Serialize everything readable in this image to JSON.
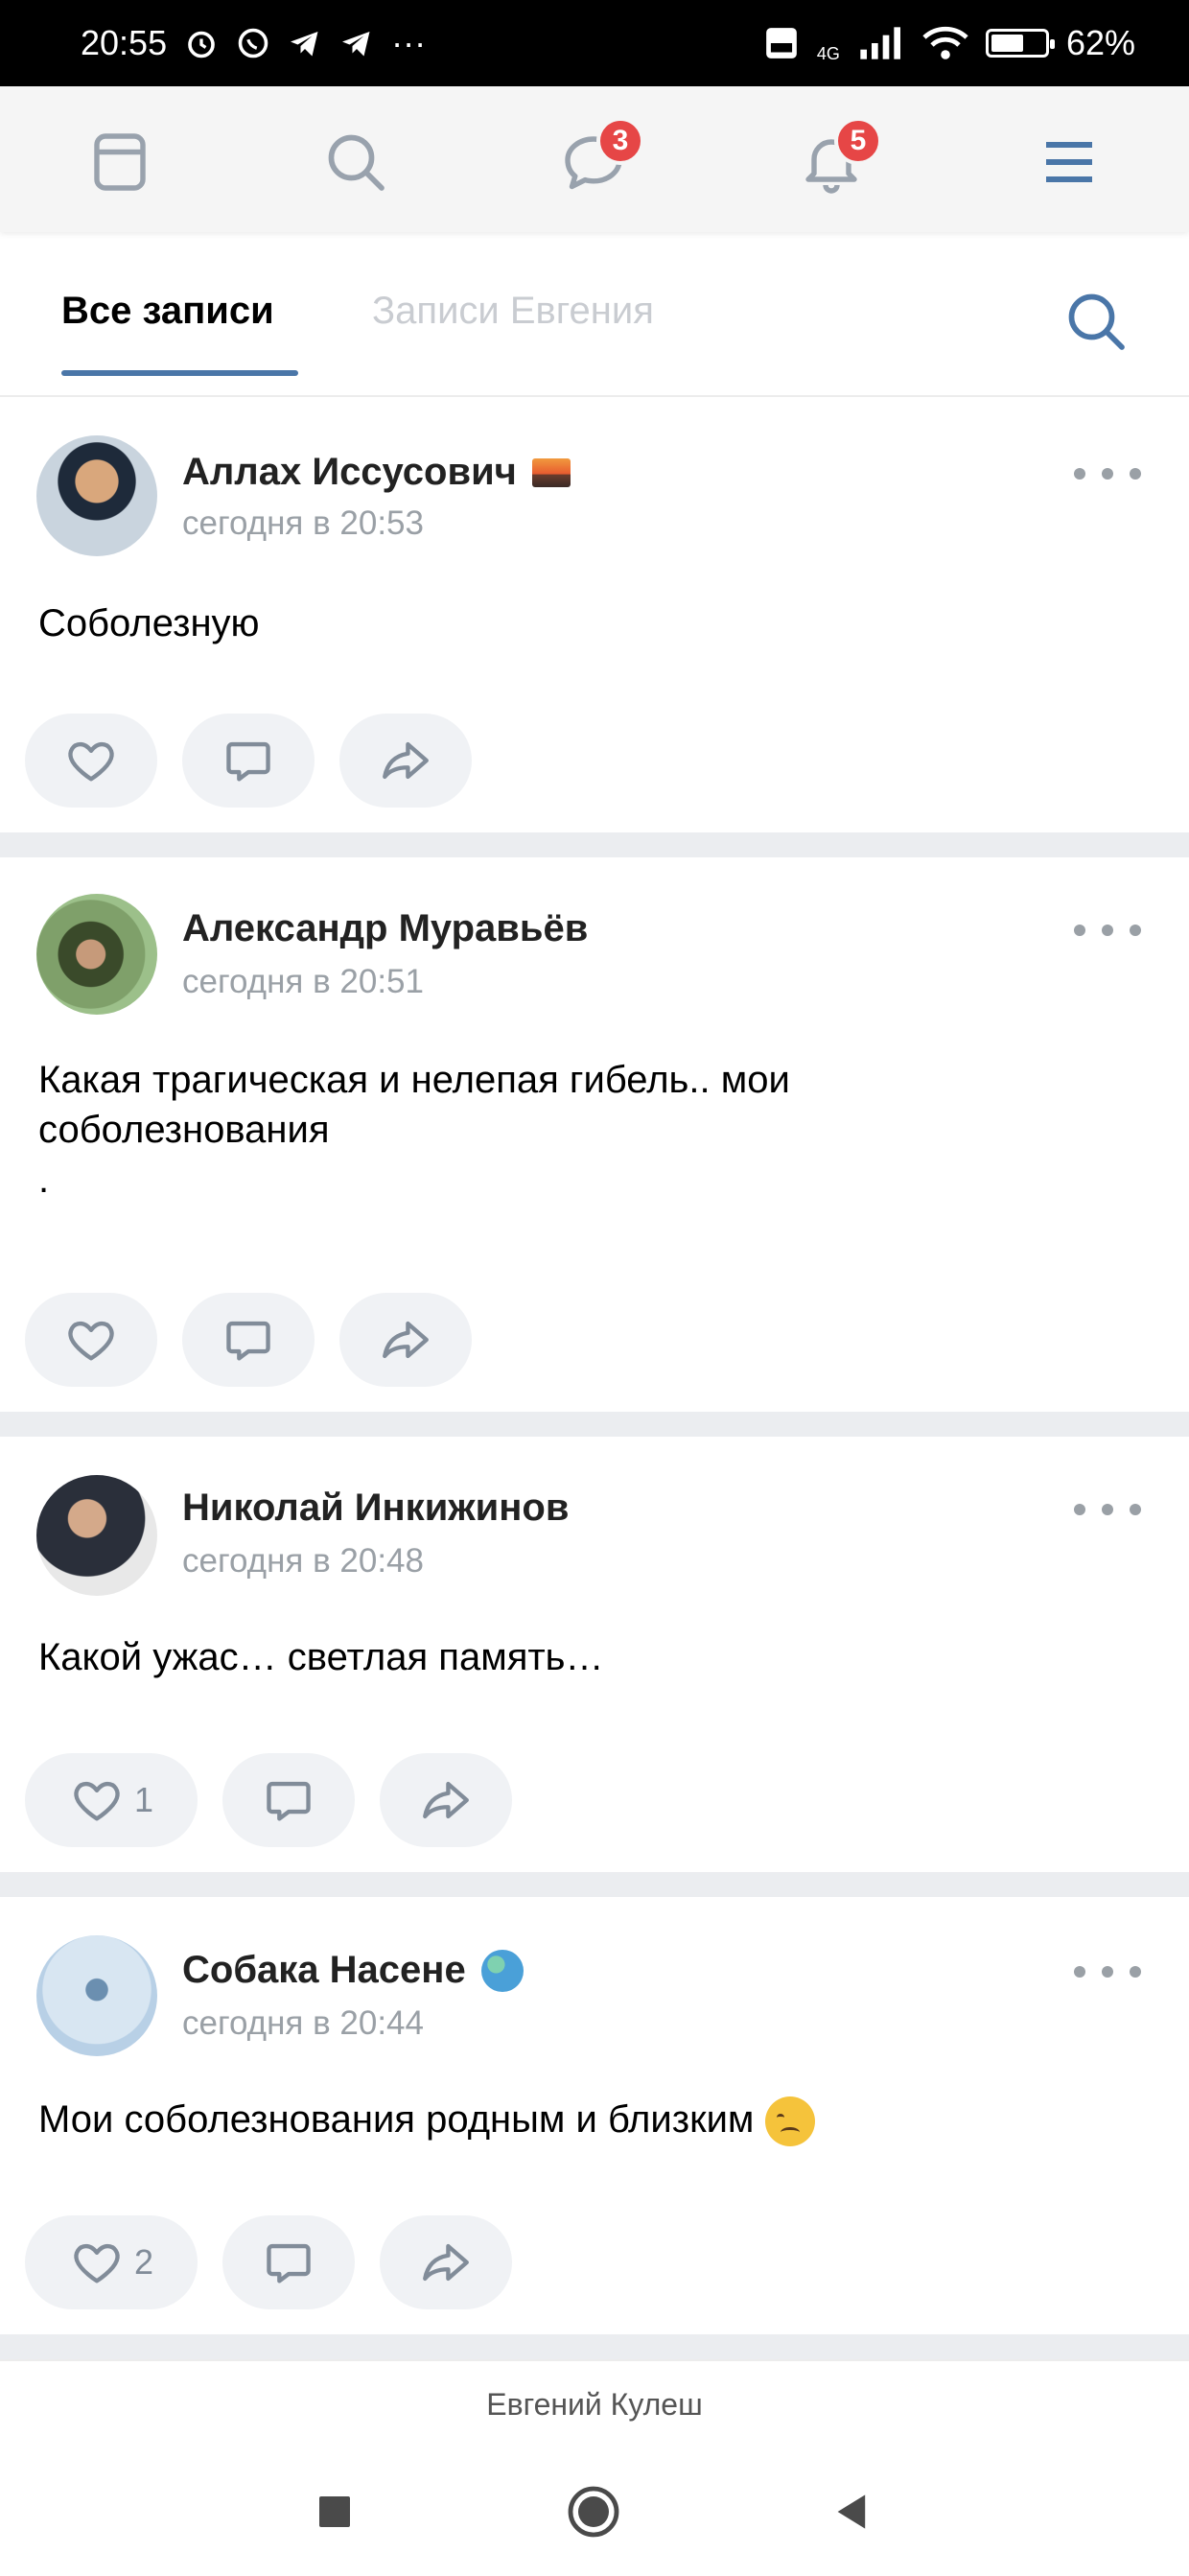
{
  "status_bar": {
    "time": "20:55",
    "more": "···",
    "network": "4G",
    "battery": "62%",
    "battery_level": 0.62
  },
  "nav": {
    "messages_badge": "3",
    "notifications_badge": "5"
  },
  "tabs": {
    "active": "Все записи",
    "inactive": "Записи Евгения"
  },
  "posts": [
    {
      "author": "Аллах Иссусович",
      "time": "сегодня в 20:53",
      "text": "Соболезную",
      "likes": ""
    },
    {
      "author": "Александр Муравьёв",
      "time": "сегодня в 20:51",
      "text": "Какая трагическая и нелепая гибель.. мои соболезнования\n.",
      "likes": ""
    },
    {
      "author": "Николай Инкижинов",
      "time": "сегодня в 20:48",
      "text": "Какой ужас… светлая память…",
      "likes": "1"
    },
    {
      "author": "Собака Насене",
      "time": "сегодня в 20:44",
      "text": "Мои соболезнования родным и близким",
      "likes": "2"
    }
  ],
  "footer": {
    "caption": "Евгений Кулеш"
  },
  "colors": {
    "accent": "#4a76a8",
    "badge": "#e64646",
    "icon": "#99a2ad",
    "separator": "#ebedf0"
  }
}
